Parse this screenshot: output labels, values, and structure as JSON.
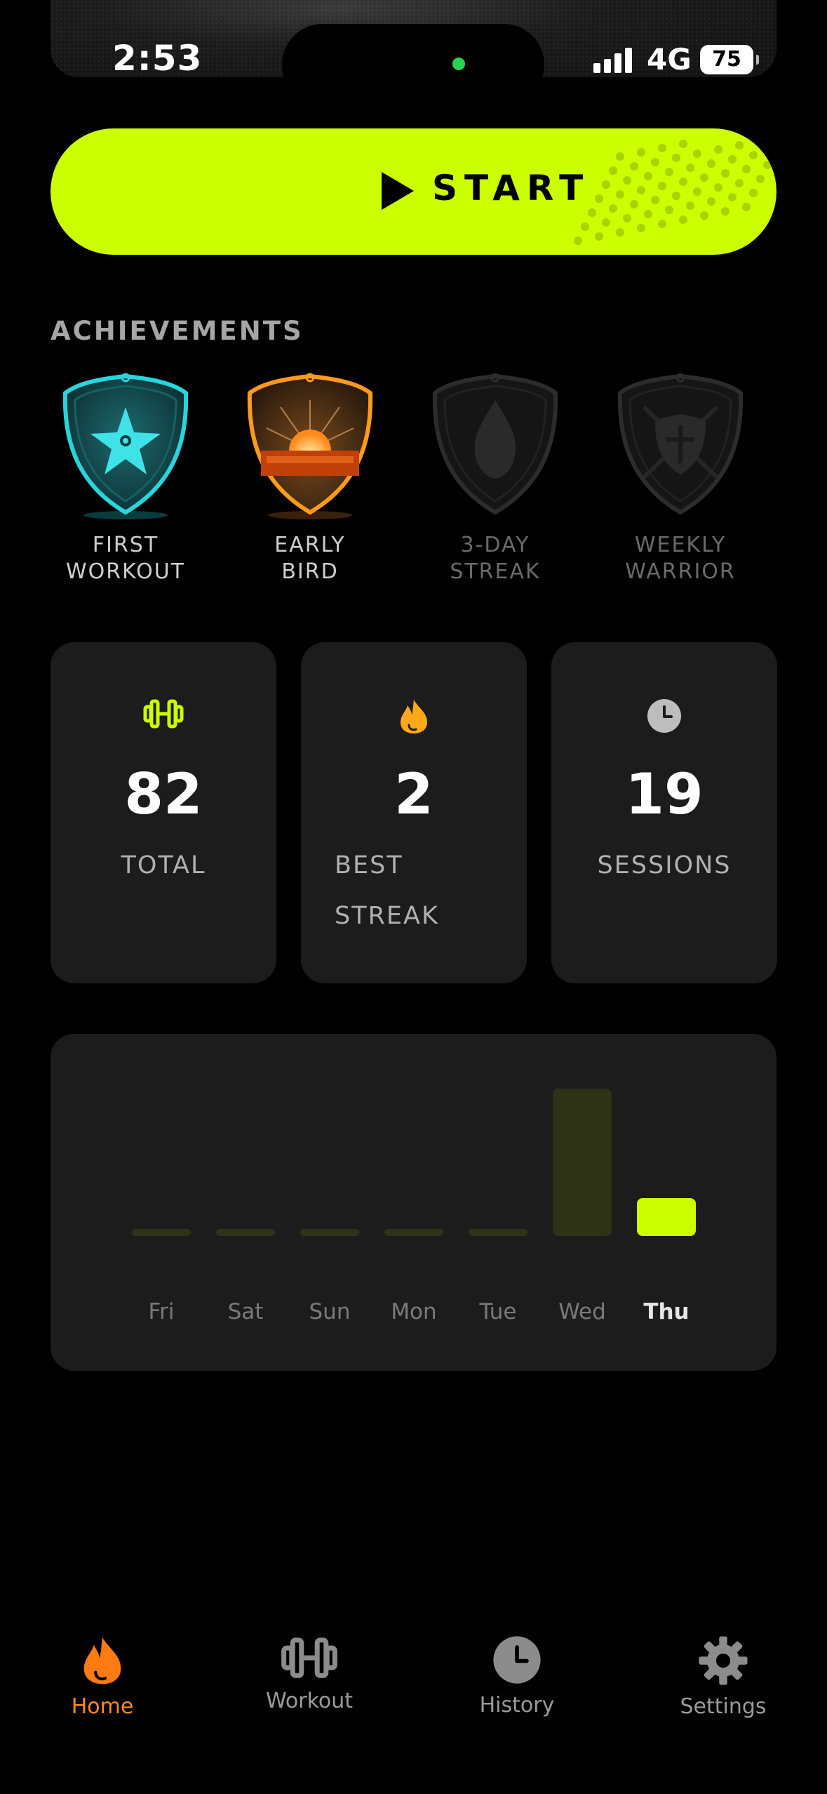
{
  "status_bar": {
    "time": "2:53",
    "network": "4G",
    "battery": "75"
  },
  "start_button": {
    "label": "START"
  },
  "achievements": {
    "title": "ACHIEVEMENTS",
    "items": [
      {
        "name": "FIRST\nWORKOUT",
        "icon": "star-shield-icon",
        "unlocked": true,
        "color": "#1fd3d8"
      },
      {
        "name": "EARLY\nBIRD",
        "icon": "sunrise-shield-icon",
        "unlocked": true,
        "color": "#ff9a1a"
      },
      {
        "name": "3-DAY\nSTREAK",
        "icon": "flame-shield-icon",
        "unlocked": false,
        "color": "#3a3a3a"
      },
      {
        "name": "WEEKLY\nWARRIOR",
        "icon": "warrior-shield-icon",
        "unlocked": false,
        "color": "#3a3a3a"
      }
    ]
  },
  "stats": [
    {
      "icon": "dumbbell-icon",
      "value": "82",
      "label": "TOTAL",
      "color": "#ccff00"
    },
    {
      "icon": "flame-icon",
      "value": "2",
      "label": "BEST\nSTREAK",
      "color": "#ffa81a"
    },
    {
      "icon": "clock-icon",
      "value": "19",
      "label": "SESSIONS",
      "color": "#bdbdbd"
    }
  ],
  "chart_data": {
    "type": "bar",
    "categories": [
      "Fri",
      "Sat",
      "Sun",
      "Mon",
      "Tue",
      "Wed",
      "Thu"
    ],
    "values": [
      0,
      0,
      0,
      0,
      0,
      19,
      2
    ],
    "highlight": "Thu",
    "colors": {
      "bar": "#ccff00",
      "dim_bar": "#2e3318"
    }
  },
  "tabs": [
    {
      "label": "Home",
      "icon": "flame-icon",
      "active": true
    },
    {
      "label": "Workout",
      "icon": "dumbbell-icon",
      "active": false
    },
    {
      "label": "History",
      "icon": "clock-icon",
      "active": false
    },
    {
      "label": "Settings",
      "icon": "gear-icon",
      "active": false
    }
  ]
}
